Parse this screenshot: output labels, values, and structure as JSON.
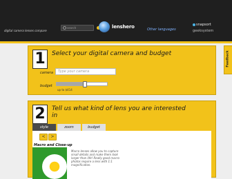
{
  "header": {
    "tagline": "digital camera lenses compare",
    "search_label": "search",
    "brand": "lenshero",
    "other_languages": "Other languages",
    "snapsort": "snapsort",
    "geekosystem": "geeksystem"
  },
  "step1": {
    "number": "1",
    "title": "Select your digital camera and budget",
    "camera_label": "camera",
    "camera_placeholder": "Type your camera",
    "budget_label": "budget",
    "budget_value": "up to $414",
    "budget_fraction": 0.55
  },
  "step2": {
    "number": "2",
    "title": "Tell us what kind of lens you are interested in",
    "tabs": [
      "style",
      "zoom",
      "budget"
    ],
    "prev": "<",
    "next": ">",
    "style_name": "Macro and Close-up",
    "style_desc": "Macro lenses allow you to capture small details and make them look larger than life! Really good macro photos require a lens with 1:1 magnification."
  },
  "feedback": "Feedback",
  "colors": {
    "accent": "#f2c21a",
    "topbar": "#1f1f1f",
    "link": "#7fb2ff"
  }
}
